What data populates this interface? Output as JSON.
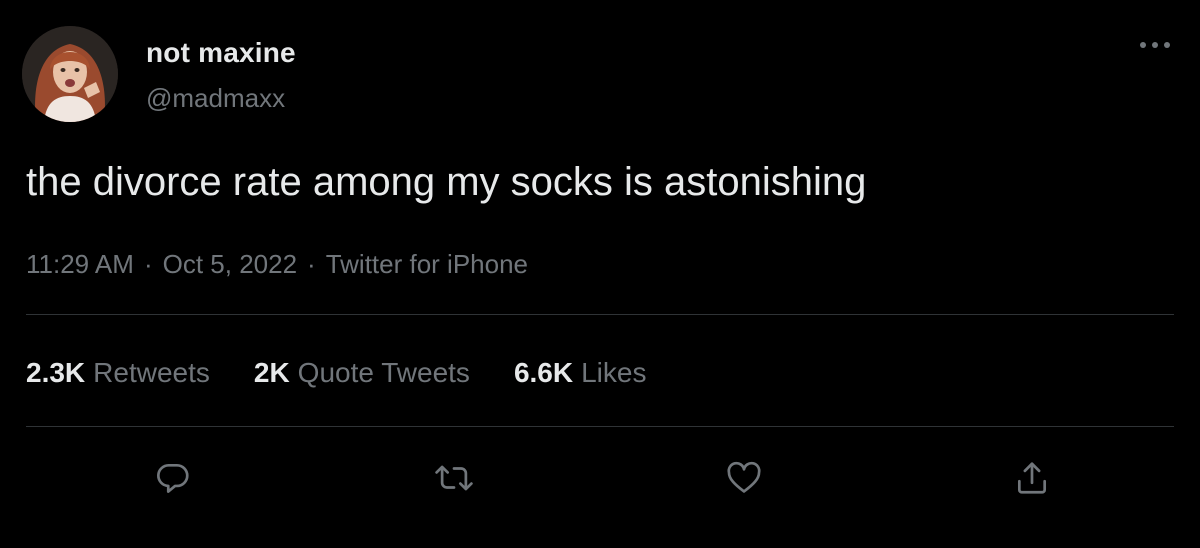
{
  "author": {
    "display_name": "not maxine",
    "handle": "@madmaxx"
  },
  "tweet": {
    "text": "the divorce rate among my socks is astonishing",
    "time": "11:29 AM",
    "date": "Oct 5, 2022",
    "source": "Twitter for iPhone",
    "separator": "·"
  },
  "stats": {
    "retweets": {
      "count": "2.3K",
      "label": "Retweets"
    },
    "quote_tweets": {
      "count": "2K",
      "label": "Quote Tweets"
    },
    "likes": {
      "count": "6.6K",
      "label": "Likes"
    }
  },
  "actions": [
    "reply-icon",
    "retweet-icon",
    "like-icon",
    "share-icon"
  ],
  "colors": {
    "background": "#000000",
    "primary_text": "#e7e9ea",
    "secondary_text": "#71767b",
    "divider": "#2f3336"
  }
}
